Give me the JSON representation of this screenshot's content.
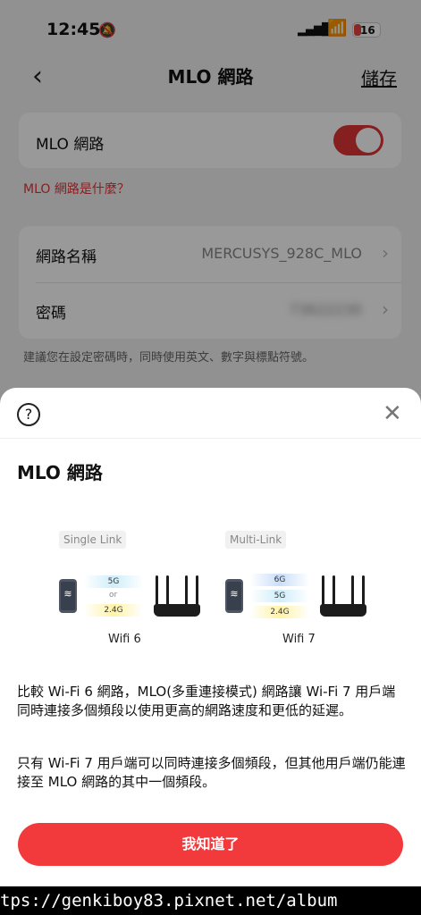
{
  "status_bar": {
    "time": "12:45",
    "battery": "16",
    "battery_color": "#e8433e"
  },
  "nav": {
    "title": "MLO 網路",
    "save_label": "儲存"
  },
  "settings": {
    "mlo_toggle_label": "MLO 網路",
    "mlo_enabled": true,
    "what_link": "MLO 網路是什麼？",
    "network_name_label": "網路名稱",
    "network_name_value": "MERCUSYS_928C_MLO",
    "password_label": "密碼",
    "password_value": "73622230",
    "password_hint": "建議您在設定密碼時，同時使用英文、數字與標點符號。"
  },
  "sheet": {
    "title": "MLO 網路",
    "single_link_tag": "Single Link",
    "multi_link_tag": "Multi-Link",
    "wifi6": {
      "bands": [
        "5G",
        "2.4G"
      ],
      "separator": "or",
      "label": "Wifi 6"
    },
    "wifi7": {
      "bands": [
        "6G",
        "5G",
        "2.4G"
      ],
      "label": "Wifi 7"
    },
    "paragraph1": "比較 Wi-Fi 6 網路，MLO(多重連接模式) 網路讓 Wi-Fi 7 用戶端同時連接多個頻段以使用更高的網路速度和更低的延遲。",
    "paragraph2": "只有 Wi-Fi 7 用戶端可以同時連接多個頻段，但其他用戶端仍能連接至 MLO 網路的其中一個頻段。",
    "confirm_button": "我知道了"
  },
  "accent_color": "#f23a3c",
  "watermark": "tps://genkiboy83.pixnet.net/album"
}
